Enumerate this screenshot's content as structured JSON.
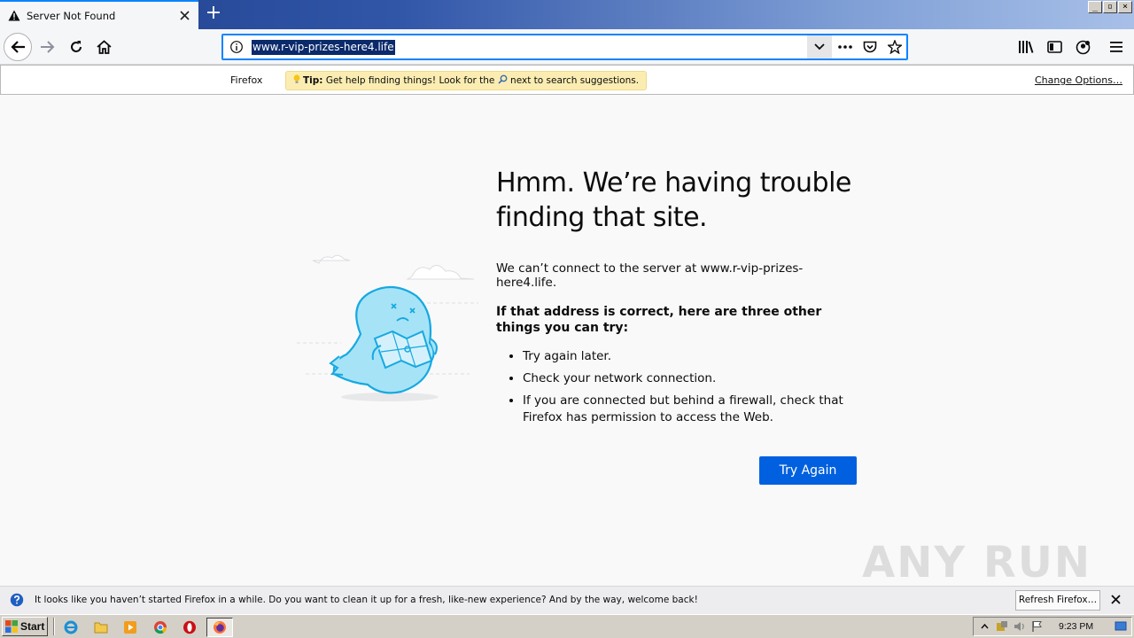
{
  "tab": {
    "title": "Server Not Found",
    "new_tab_symbol": "+"
  },
  "window_buttons": [
    "_",
    "▫",
    "×"
  ],
  "url": "www.r-vip-prizes-here4.life",
  "search_tip": {
    "engine_label": "Firefox",
    "tip_bold": "Tip:",
    "tip_text": " Get help finding things! Look for the ",
    "tip_text_after": " next to search suggestions.",
    "change_options": "Change Options…"
  },
  "error": {
    "heading": "Hmm. We’re having trouble finding that site.",
    "description": "We can’t connect to the server at www.r-vip-prizes-here4.life.",
    "suggest_title": "If that address is correct, here are three other things you can try:",
    "suggestions": [
      "Try again later.",
      "Check your network connection.",
      "If you are connected but behind a firewall, check that Firefox has permission to access the Web."
    ],
    "try_again": "Try Again"
  },
  "watermark": "ANY RUN",
  "notification": {
    "message": "It looks like you haven’t started Firefox in a while. Do you want to clean it up for a fresh, like-new experience? And by the way, welcome back!",
    "refresh_button": "Refresh Firefox…"
  },
  "taskbar": {
    "start_label": "Start",
    "clock": "9:23 PM",
    "quick_launch": [
      "ie-icon",
      "folder-icon",
      "media-player-icon",
      "chrome-icon",
      "opera-icon",
      "firefox-icon"
    ]
  },
  "colors": {
    "accent": "#0a84ff",
    "primary_button": "#0060df",
    "url_selection": "#0b2a6c",
    "tip_background": "#fbedb2"
  }
}
